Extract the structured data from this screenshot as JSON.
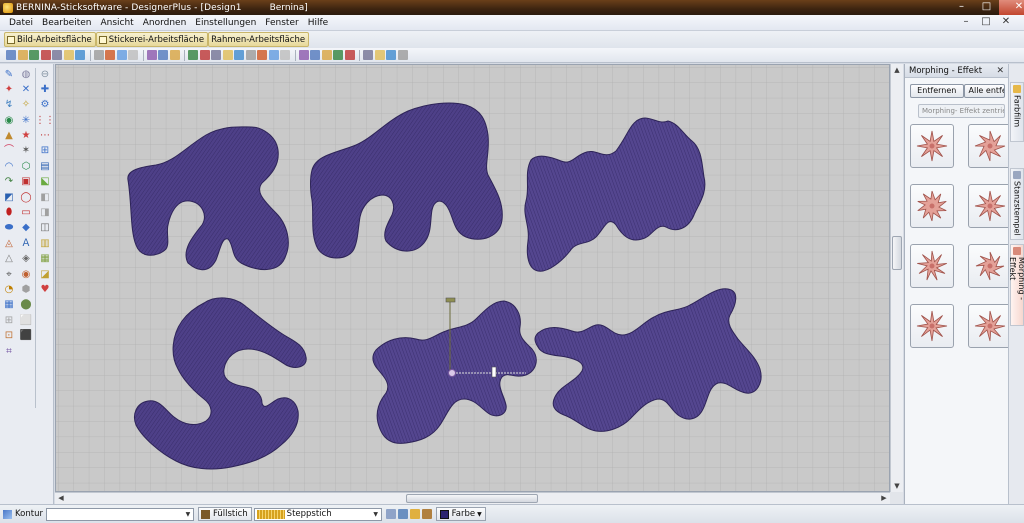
{
  "window": {
    "title": "BERNINA-Sticksoftware - DesignerPlus - [Design1",
    "title_right": "Bernina]",
    "controls": [
      "–",
      "□",
      "✕"
    ]
  },
  "menu": {
    "items": [
      "Datei",
      "Bearbeiten",
      "Ansicht",
      "Anordnen",
      "Einstellungen",
      "Fenster",
      "Hilfe"
    ],
    "mdi_controls": [
      "–",
      "□",
      "✕"
    ]
  },
  "workspaces": {
    "tabs": [
      "Bild-Arbeitsfläche",
      "Stickerei-Arbeitsfläche",
      "Rahmen-Arbeitsfläche"
    ]
  },
  "docker": {
    "title": "Morphing - Effekt",
    "remove_label": "Entfernen",
    "remove_all_label": "Alle entfernen",
    "center_label": "Morphing- Effekt zentrieren",
    "effects": [
      "star-8",
      "star-spiral",
      "star-wavy",
      "star-8b",
      "star-8c",
      "star-curl",
      "star-8d",
      "star-8e"
    ]
  },
  "side_tabs": [
    "Farbfilm",
    "Stanzstempel",
    "Morphing - Effekt"
  ],
  "statusbar": {
    "outline_label": "Kontur",
    "outline_value": "",
    "fill_label": "Füllstich",
    "stitch_label": "Steppstich",
    "color_label": "Farbe"
  },
  "colors": {
    "embroidery": "#4b3d82",
    "canvas": "#c9c9c9",
    "grid": "#b0b0b0",
    "accent_tab": "#e7d89a"
  }
}
